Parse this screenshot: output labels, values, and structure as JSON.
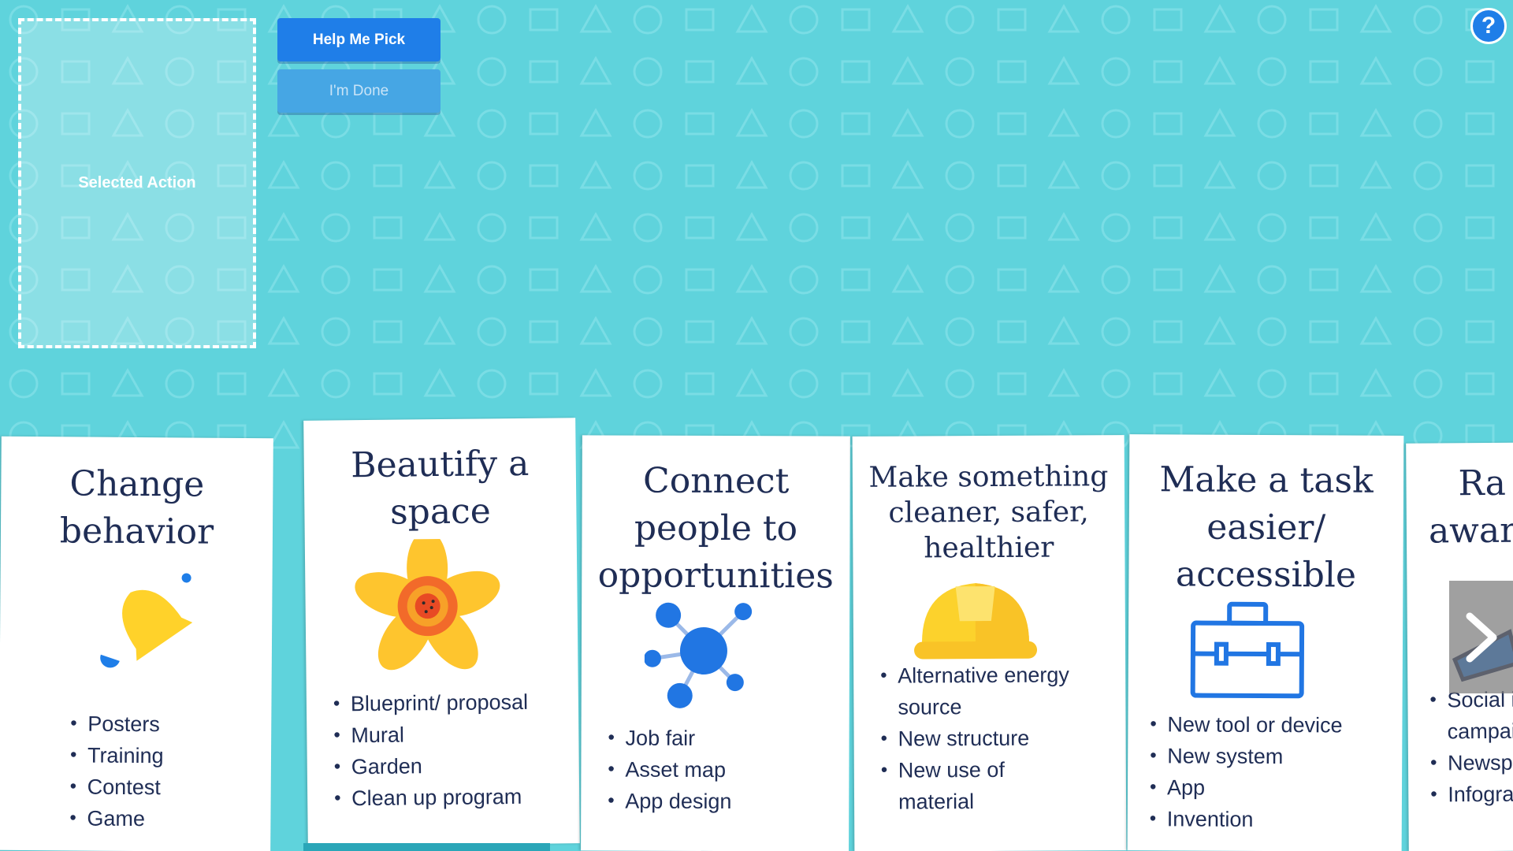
{
  "drop_zone": {
    "label": "Selected Action"
  },
  "buttons": {
    "help_pick": "Help Me Pick",
    "done": "I'm Done"
  },
  "help_icon": "?",
  "cards": [
    {
      "title_lines": [
        "Change",
        "behavior"
      ],
      "icon": "bell-icon",
      "items": [
        "Posters",
        "Training",
        "Contest",
        "Game"
      ]
    },
    {
      "title_lines": [
        "Beautify a",
        "space"
      ],
      "icon": "flower-icon",
      "items": [
        "Blueprint/ proposal",
        "Mural",
        "Garden",
        "Clean up program"
      ]
    },
    {
      "title_lines": [
        "Connect",
        "people to",
        "opportunities"
      ],
      "icon": "network-icon",
      "items": [
        "Job fair",
        "Asset map",
        "App design"
      ]
    },
    {
      "title_lines": [
        "Make something",
        "cleaner, safer,",
        "healthier"
      ],
      "icon": "hard-hat-icon",
      "items": [
        "Alternative energy",
        "source",
        "New structure",
        "New use of",
        "material"
      ]
    },
    {
      "title_lines": [
        "Make a task",
        "easier/",
        "accessible"
      ],
      "icon": "toolbox-icon",
      "items": [
        "New tool or device",
        "New system",
        "App",
        "Invention"
      ]
    },
    {
      "title_lines": [
        "Ra",
        "awar"
      ],
      "icon": "megaphone-icon",
      "items": [
        "Social i",
        "campai",
        "Newsp",
        "Infogra"
      ]
    }
  ],
  "next_icon": "chevron-right-icon",
  "colors": {
    "background": "#5fd3dc",
    "primary": "#1f7ee8",
    "text": "#1f2d55"
  }
}
